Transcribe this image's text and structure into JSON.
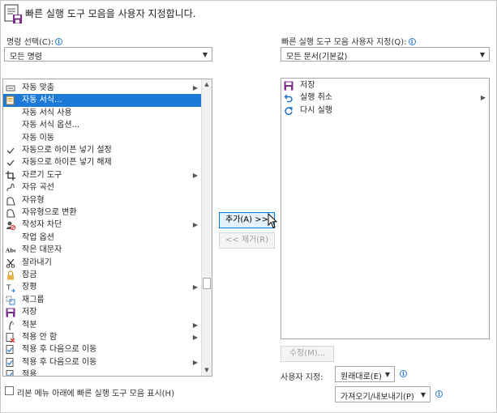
{
  "header": {
    "title": "빠른 실행 도구 모음을 사용자 지정합니다."
  },
  "left": {
    "command_label": "명령 선택(C):",
    "command_value": "모든 명령",
    "items": [
      {
        "label": "자동 맞춤",
        "icon": "autofit-icon",
        "submenu": true
      },
      {
        "label": "자동 서식...",
        "icon": "autoformat-icon",
        "selected": true
      },
      {
        "label": "자동 서식 사용",
        "icon": ""
      },
      {
        "label": "자동 서식 옵션...",
        "icon": ""
      },
      {
        "label": "자동 이동",
        "icon": ""
      },
      {
        "label": "자동으로 하이픈 넣기 설정",
        "icon": "check-icon"
      },
      {
        "label": "자동으로 하이픈 넣기 해제",
        "icon": "check-icon"
      },
      {
        "label": "자르기 도구",
        "icon": "crop-icon",
        "submenu": true
      },
      {
        "label": "자유 곡선",
        "icon": "freeform-curve-icon"
      },
      {
        "label": "자유형",
        "icon": "freeform-shape-icon"
      },
      {
        "label": "자유형으로 변환",
        "icon": "convert-freeform-icon"
      },
      {
        "label": "작성자 차단",
        "icon": "block-author-icon",
        "submenu": true
      },
      {
        "label": "작업 옵션",
        "icon": ""
      },
      {
        "label": "작은 대문자",
        "icon": "small-caps-icon"
      },
      {
        "label": "잘라내기",
        "icon": "scissors-icon"
      },
      {
        "label": "잠금",
        "icon": "lock-icon"
      },
      {
        "label": "장평",
        "icon": "char-scale-icon",
        "submenu": true
      },
      {
        "label": "재그룹",
        "icon": "regroup-icon"
      },
      {
        "label": "저장",
        "icon": "save-icon"
      },
      {
        "label": "적분",
        "icon": "integral-icon",
        "submenu": true
      },
      {
        "label": "적용 안 함",
        "icon": "reject-icon",
        "submenu": true
      },
      {
        "label": "적용 후 다음으로 이동",
        "icon": "accept-next-icon"
      },
      {
        "label": "적용 후 다음으로 이동",
        "icon": "accept-next-icon",
        "submenu": true
      },
      {
        "label": "적용",
        "icon": "accept-icon"
      }
    ],
    "ribbon_checkbox_label": "리본 메뉴 아래에 빠른 실행 도구 모음 표시(H)"
  },
  "middle": {
    "add_label": "추가(A) >>",
    "remove_label": "<< 제거(R)"
  },
  "right": {
    "customize_label": "빠른 실행 도구 모음 사용자 지정(Q):",
    "customize_value": "모든 문서(기본값)",
    "items": [
      {
        "label": "저장",
        "icon": "save-icon"
      },
      {
        "label": "실행 취소",
        "icon": "undo-icon",
        "submenu": true
      },
      {
        "label": "다시 실행",
        "icon": "redo-icon"
      }
    ],
    "modify_label": "수정(M)...",
    "user_custom_label": "사용자 지정:",
    "reset_label": "원래대로(E)",
    "import_export_label": "가져오기/내보내기(P)"
  },
  "colors": {
    "selection": "#1c79d6",
    "save_purple": "#7b2e8e",
    "link_blue": "#2b7cd3"
  }
}
